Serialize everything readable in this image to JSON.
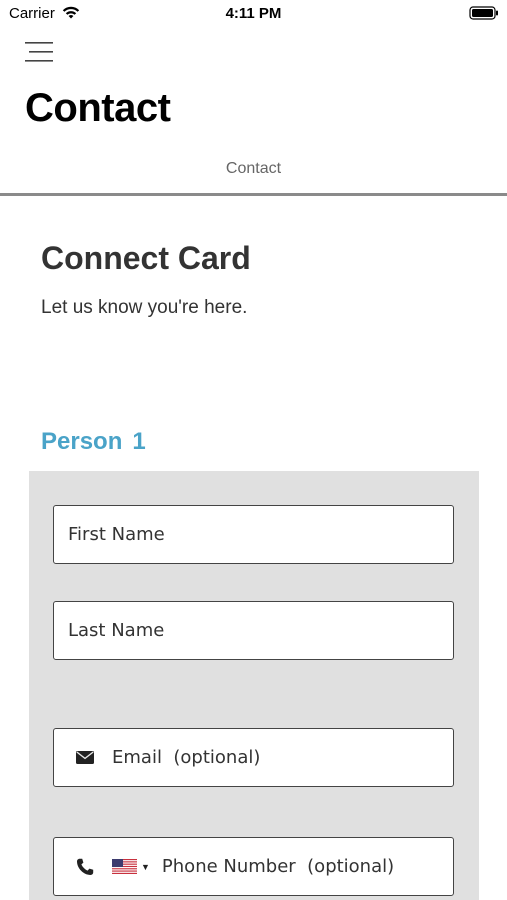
{
  "status_bar": {
    "carrier": "Carrier",
    "time": "4:11 PM",
    "icons": [
      "wifi-icon",
      "battery-icon"
    ]
  },
  "header": {
    "menu_icon": "hamburger-menu-icon",
    "title": "Contact"
  },
  "tabs": {
    "active": "Contact"
  },
  "card": {
    "title": "Connect Card",
    "subtitle": "Let us know you're here."
  },
  "person": {
    "label": "Person",
    "number": "1",
    "color": "#4aa3c8"
  },
  "form": {
    "first_name_placeholder": "First Name",
    "last_name_placeholder": "Last Name",
    "email_placeholder": "Email  (optional)",
    "phone_placeholder": "Phone Number  (optional)",
    "email_icon": "envelope-icon",
    "phone_icon": "phone-icon",
    "country_flag": "us-flag-icon"
  }
}
